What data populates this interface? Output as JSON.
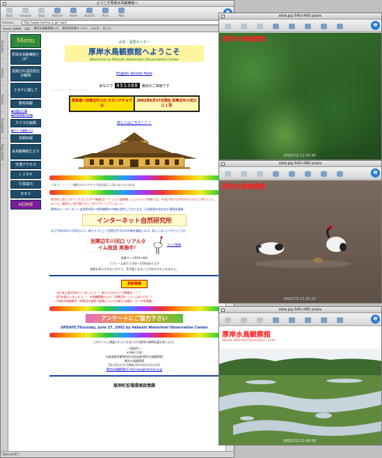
{
  "main": {
    "title": "ようこそ厚岸水鳥観察館へ",
    "toolbar": [
      "Back",
      "Forward",
      "Stop",
      "Refresh",
      "Home",
      "AutoFill",
      "Print",
      "Mail"
    ],
    "address_label": "Address",
    "address": "http://www.marimo.or.jp/~aws/",
    "favorites": [
      "Yahoo! JAPAN",
      "AOL",
      "厚岸水鳥観察館入口",
      "厚岸町役場ホームペ",
      "ぶん本",
      "まいぷ"
    ],
    "side_tabs": [
      "Favorites",
      "History",
      "Search",
      "Scrapbook",
      "Page Holder"
    ],
    "nav": [
      "Menu",
      "厚岸水鳥観察館とは？",
      "別寒辺牛湿原周辺の動物",
      "ＩＢＰに関して",
      "野鳥情報",
      "カメラの画像",
      "鳥類目録",
      "水鳥観察館だより",
      "交通アクセス",
      "ＬＩＮＫ",
      "行事案内",
      "ＢＢＳ",
      "HOME"
    ],
    "nav_links": [
      "◆年間の行事",
      "◆野鳥情報の詳細",
      "◆カメラ画像入口"
    ],
    "subtitle": "水鳥・湿原センター",
    "page_title": "厚岸水鳥観察館へようこそ",
    "page_title_en": "Welcome to Akkeshi Waterfowl Observation Center",
    "english_link": "English Version Here",
    "counter_pre": "あなたで",
    "counter": "051388",
    "counter_post": "番目のご来館です",
    "info_left": "厚岸湖～別寒辺牛川の オオハクチョウは",
    "info_right": "2002年6月27日現在 別寒辺牛川河口に１羽",
    "detail_link": "詳しくはこちら！！！",
    "marquee": "＜ｂ＞・・・・・現在オオハクチョウは付近に１羽いないています。",
    "para1": "厚岸町に遊んできていただいたＭＴ機器(注)「たっぷり展開機」によるライブ映像では、平成13年５月29日をもちまして終了いたしました。開設をご協力賜りましてありがとうございました。",
    "para2": "現時点(インターネット自然研究所)で野鳥観察の中継を提供しております。日本野鳥の会を含む環境省事業",
    "banner": "インターネット自然研究所",
    "para3": "また平成14年５月20日より、新カメラとして別寒辺牛河口の中継を開始します。詳しくはリンクからどうぞ。",
    "live_title": "別寒辺牛川河口 リアルタイム放送 実施中！",
    "live_link": "ライブ映像",
    "size_note": "画像サイズ640×480",
    "size_note2": "１フレームあたり100～150kbあります",
    "view_note": "画像を表示されないかたで、音が遅くなることがあるかもしれません。",
    "news_label": "更新情報",
    "news": [
      "・まだ未公表があれていましたっ！！ 新カメラのライブ映像は ！！！",
      "・6月を表示しましたっ！！ 水鳥観察館たより「別寒辺牛」にいっぱいです！！",
      "・平成14年度厚岸・別寒辺牛湿原で夏鳥についての新たな報告・データを掲載。"
    ],
    "anq": "アンケートにご協力下さい",
    "update": "UPDATE:Thursday, June 27, 2002 by Akkeshi Waterfowl Observation Center",
    "copyright": "このサイトに掲載されている全ての写真等の無断転載を禁じます。",
    "address_lines": [
      "＜連絡先＞",
      "〒088-1100",
      "北海道厚岸郡厚岸町太田宏陽(厚岸水鳥観察館)",
      "厚岸水鳥観察館",
      "TEL:0153-52-5988 FAX:0153-53-2121",
      "厚岸水鳥観察館 E-mail:aws@marimo.or.jp"
    ],
    "footer": "厚岸町役場環境政策課",
    "status": "読み込み完了"
  },
  "cams": [
    {
      "title": "ebiw.jpg 640×480 pixels",
      "label": "厚岸水鳥観察館",
      "time": "2002/7/3 11:33:46"
    },
    {
      "title": "ebiw.jpg 640×480 pixels",
      "label": "厚岸水鳥観察館",
      "time": "2002/7/3 11:35:23"
    },
    {
      "title": "ebiw.jpg 640×480 pixels",
      "label": "厚岸水鳥観察館",
      "sublabel": "Akkeshi Waterfowl Observation Center",
      "time": "2002/7/3 11:43:29"
    }
  ],
  "colors": {
    "accent": "#1e4d6a",
    "title_blue": "#1a4ea0",
    "warning_red": "#c00000",
    "highlight": "#ffe000"
  }
}
